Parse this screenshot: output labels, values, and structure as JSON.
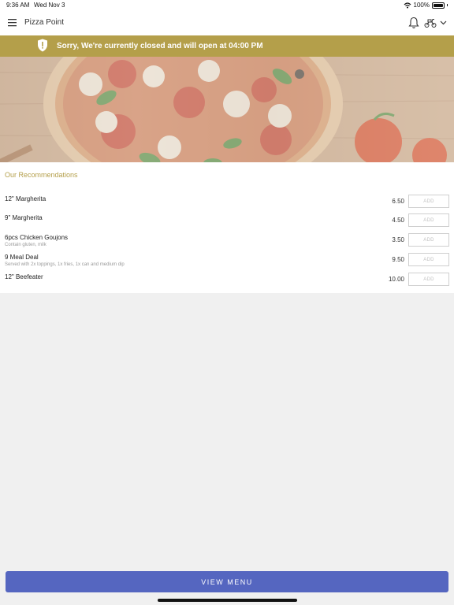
{
  "status_bar": {
    "time": "9:36 AM",
    "date": "Wed Nov 3",
    "battery": "100%"
  },
  "header": {
    "title": "Pizza Point"
  },
  "banner": {
    "message": "Sorry, We're currently closed and will open at 04:00 PM"
  },
  "recommendations": {
    "heading": "Our Recommendations",
    "items": [
      {
        "name": "12\" Margherita",
        "description": "",
        "price": "6.50",
        "add_label": "ADD"
      },
      {
        "name": "9\" Margherita",
        "description": "",
        "price": "4.50",
        "add_label": "ADD"
      },
      {
        "name": "6pcs Chicken Goujons",
        "description": "Contain gluten, milk",
        "price": "3.50",
        "add_label": "ADD"
      },
      {
        "name": "9 Meal Deal",
        "description": "Served with 2x toppings, 1x fries, 1x can and medium dip",
        "price": "9.50",
        "add_label": "ADD"
      },
      {
        "name": "12\" Beefeater",
        "description": "",
        "price": "10.00",
        "add_label": "ADD"
      }
    ]
  },
  "footer": {
    "view_menu_label": "VIEW MENU"
  },
  "colors": {
    "accent": "#b49f4a",
    "button": "#5566c0"
  }
}
